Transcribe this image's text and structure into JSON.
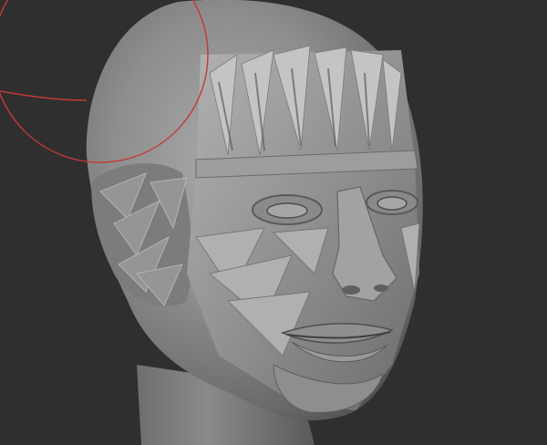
{
  "viewport": {
    "background_color": "#2f2f2f",
    "brush_cursor_color": "#c23a3a",
    "model_color": "#8c8c8c"
  }
}
